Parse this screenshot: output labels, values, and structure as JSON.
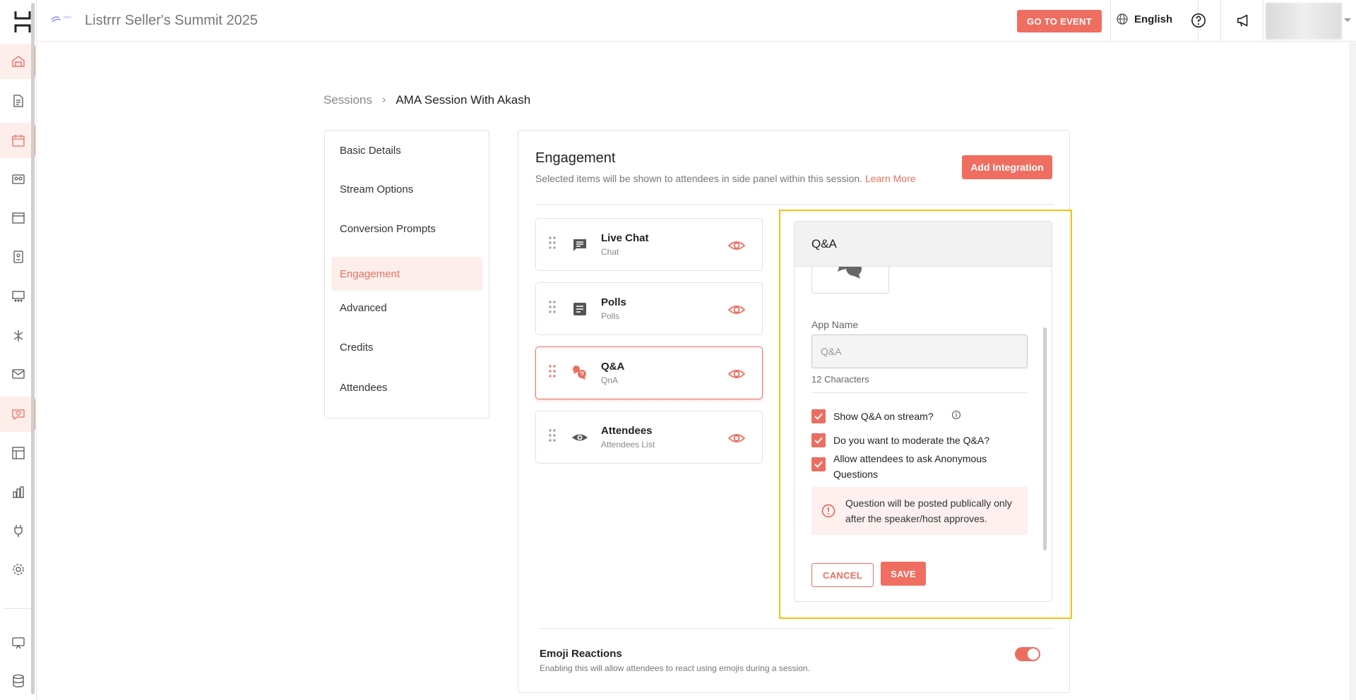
{
  "topbar": {
    "logo_text": "listrrr",
    "event_title": "Listrrr Seller's Summit 2025",
    "go_to_event": "GO TO EVENT",
    "language": "English"
  },
  "breadcrumb": {
    "parent": "Sessions",
    "separator": "›",
    "current": "AMA Session With Akash"
  },
  "session_nav": {
    "items": [
      {
        "label": "Basic Details"
      },
      {
        "label": "Stream Options"
      },
      {
        "label": "Conversion Prompts"
      },
      {
        "label": "Engagement"
      },
      {
        "label": "Advanced"
      },
      {
        "label": "Credits"
      },
      {
        "label": "Attendees"
      }
    ],
    "active": "Engagement"
  },
  "engagement": {
    "title": "Engagement",
    "subtitle": "Selected items will be shown to attendees in side panel within this session.",
    "learn_more": "Learn More",
    "add_integration": "Add Integration",
    "apps": [
      {
        "name": "Live Chat",
        "sub": "Chat",
        "icon": "chat-icon"
      },
      {
        "name": "Polls",
        "sub": "Polls",
        "icon": "poll-icon"
      },
      {
        "name": "Q&A",
        "sub": "QnA",
        "icon": "qna-icon"
      },
      {
        "name": "Attendees",
        "sub": "Attendees List",
        "icon": "eye-icon"
      }
    ],
    "selected_app": "Q&A"
  },
  "qa_panel": {
    "title": "Q&A",
    "app_name_label": "App Name",
    "app_name_placeholder": "Q&A",
    "characters": "12 Characters",
    "opt_show_stream": "Show Q&A on stream?",
    "opt_moderate": "Do you want to moderate the Q&A?",
    "opt_anonymous": "Allow attendees to ask Anonymous Questions",
    "notice": "Question will be posted publically only after the speaker/host approves.",
    "cancel": "CANCEL",
    "save": "SAVE"
  },
  "emoji": {
    "title": "Emoji Reactions",
    "subtitle": "Enabling this will allow attendees to react using emojis during a session.",
    "enabled": true
  },
  "colors": {
    "accent": "#ef6e61",
    "accent_light": "#fdeeec",
    "highlight_outline": "#f4c20d"
  }
}
